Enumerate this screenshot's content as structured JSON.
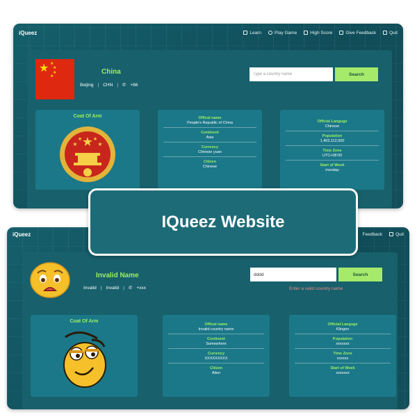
{
  "banner": {
    "title": "IQueez Website"
  },
  "nav": {
    "brand": "iQueez",
    "links": [
      "Learn",
      "Play Game",
      "High Score",
      "Give Feedback",
      "Quit"
    ],
    "partial_links": [
      "Feedback",
      "Quit"
    ]
  },
  "top": {
    "country_name": "China",
    "capital": "Beijing",
    "code": "CHN",
    "phone": "+86",
    "search": {
      "placeholder": "Type a country name",
      "button": "Search"
    },
    "coat_title": "Coat Of Arm",
    "middle_fields": [
      {
        "label": "Offical name",
        "value": "People's Republic of China"
      },
      {
        "label": "Continent",
        "value": "Asia"
      },
      {
        "label": "Currency",
        "value": "Chinese yuan"
      },
      {
        "label": "Citizen",
        "value": "Chinese"
      }
    ],
    "right_fields": [
      {
        "label": "Official Languge",
        "value": "Chinese"
      },
      {
        "label": "Population",
        "value": "1,402,112,000"
      },
      {
        "label": "Time Zone",
        "value": "UTC+08:00"
      },
      {
        "label": "Start of Week",
        "value": "monday"
      }
    ]
  },
  "bottom": {
    "country_name": "Invalid Name",
    "capital": "Invalid",
    "code": "Invalid",
    "phone": "+xxx",
    "search": {
      "value": "dddd",
      "button": "Search"
    },
    "error": "Enter a valid country name",
    "coat_title": "Coat Of Arm",
    "middle_fields": [
      {
        "label": "Offical name",
        "value": "Invalid country name"
      },
      {
        "label": "Continent",
        "value": "Somewhere"
      },
      {
        "label": "Currency",
        "value": "XXXXXXXXX"
      },
      {
        "label": "Citizen",
        "value": "Alien"
      }
    ],
    "right_fields": [
      {
        "label": "Official Languge",
        "value": "Klingon"
      },
      {
        "label": "Population",
        "value": "xxxxxxx"
      },
      {
        "label": "Time Zone",
        "value": "xxxxxx"
      },
      {
        "label": "Start of Week",
        "value": "xxxxxxx"
      }
    ]
  },
  "colors": {
    "accent": "#9ef062",
    "button": "#a5ea6b",
    "panel": "#17606c",
    "card": "#1b7888",
    "error": "#f08a80"
  }
}
